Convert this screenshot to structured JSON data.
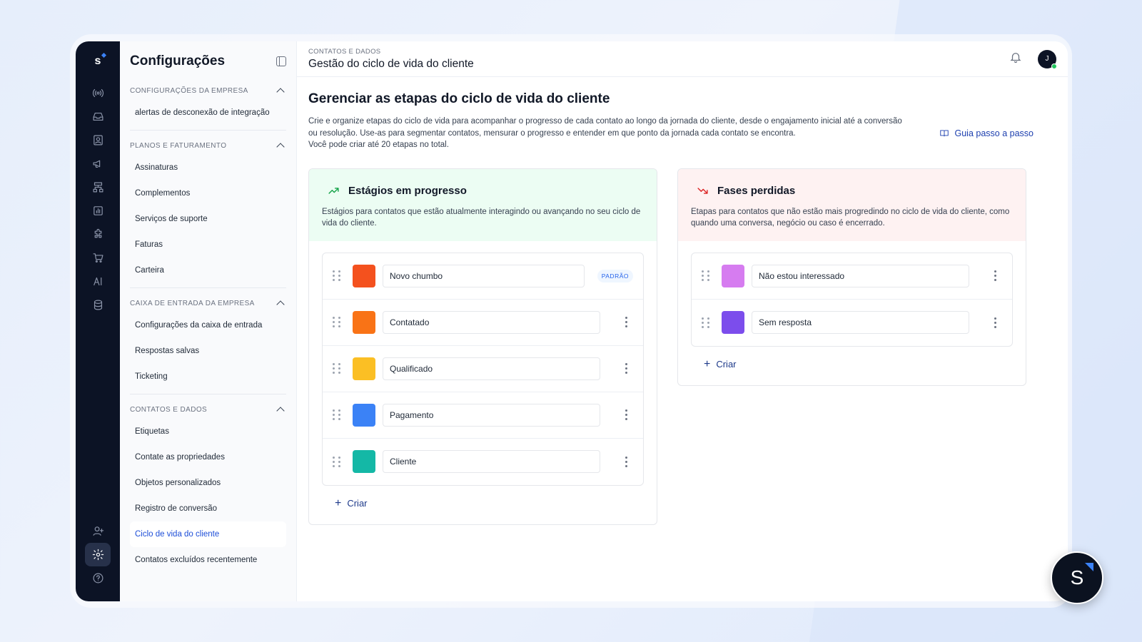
{
  "app": {
    "logo_letter": "s"
  },
  "sidebar": {
    "title": "Configurações",
    "sections": [
      {
        "title": "CONFIGURAÇÕES DA EMPRESA",
        "items": [
          "alertas de desconexão de integração"
        ]
      },
      {
        "title": "PLANOS E FATURAMENTO",
        "items": [
          "Assinaturas",
          "Complementos",
          "Serviços de suporte",
          "Faturas",
          "Carteira"
        ]
      },
      {
        "title": "CAIXA DE ENTRADA DA EMPRESA",
        "items": [
          "Configurações da caixa de entrada",
          "Respostas salvas",
          "Ticketing"
        ]
      },
      {
        "title": "CONTATOS E DADOS",
        "items": [
          "Etiquetas",
          "Contate as propriedades",
          "Objetos personalizados",
          "Registro de conversão",
          "Ciclo de vida do cliente",
          "Contatos excluídos recentemente"
        ]
      }
    ],
    "active_item": "Ciclo de vida do cliente"
  },
  "rail": {
    "top_icons": [
      "broadcast-icon",
      "inbox-icon",
      "contacts-icon",
      "megaphone-icon",
      "workflow-icon",
      "reports-icon",
      "integrations-icon",
      "shop-icon",
      "ai-icon",
      "database-icon"
    ],
    "bottom_icons": [
      "add-user-icon",
      "settings-icon",
      "help-icon"
    ]
  },
  "header": {
    "breadcrumb": "CONTATOS E DADOS",
    "title": "Gestão do ciclo de vida do cliente",
    "avatar_initial": "J"
  },
  "main": {
    "heading": "Gerenciar as etapas do ciclo de vida do cliente",
    "description": "Crie e organize etapas do ciclo de vida para acompanhar o progresso de cada contato ao longo da jornada do cliente, desde o engajamento inicial até a conversão ou resolução. Use-as para segmentar contatos, mensurar o progresso e entender em que ponto da jornada cada contato se encontra.",
    "description_limit": "Você pode criar até 20 etapas no total.",
    "guide_label": "Guia passo a passo"
  },
  "progress_card": {
    "title": "Estágios em progresso",
    "description": "Estágios para contatos que estão atualmente interagindo ou avançando no seu ciclo de vida do cliente.",
    "stages": [
      {
        "name": "Novo chumbo",
        "color": "#f4511e",
        "badge": "PADRÃO"
      },
      {
        "name": "Contatado",
        "color": "#f97316"
      },
      {
        "name": "Qualificado",
        "color": "#fbbf24"
      },
      {
        "name": "Pagamento",
        "color": "#3b82f6"
      },
      {
        "name": "Cliente",
        "color": "#14b8a6"
      }
    ],
    "create_label": "Criar"
  },
  "lost_card": {
    "title": "Fases perdidas",
    "description": "Etapas para contatos que não estão mais progredindo no ciclo de vida do cliente, como quando uma conversa, negócio ou caso é encerrado.",
    "stages": [
      {
        "name": "Não estou interessado",
        "color": "#d67cf0"
      },
      {
        "name": "Sem resposta",
        "color": "#7c4dec"
      }
    ],
    "create_label": "Criar"
  },
  "fab": {
    "letter": "S"
  }
}
